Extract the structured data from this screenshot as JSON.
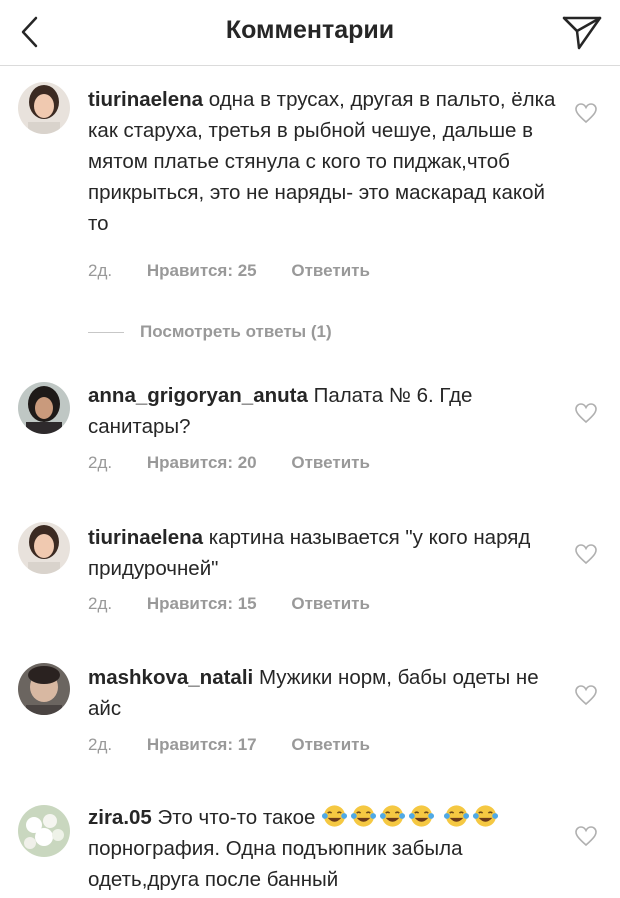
{
  "header": {
    "title": "Комментарии",
    "back_icon": "chevron-left-icon",
    "send_icon": "paper-plane-icon"
  },
  "comments": [
    {
      "username": "tiurinaelena",
      "text": "одна в трусах, другая в пальто, ёлка как старуха, третья в рыбной чешуе, дальше в мятом платье стянула с кого то пиджак,чтоб прикрыться, это не наряды- это маскарад какой то",
      "time": "2д.",
      "likes": "Нравится: 25",
      "reply": "Ответить"
    },
    {
      "username": "anna_grigoryan_anuta",
      "text": "Палата № 6. Где санитары?",
      "time": "2д.",
      "likes": "Нравится: 20",
      "reply": "Ответить"
    },
    {
      "username": "tiurinaelena",
      "text": "картина называется \"у кого наряд придурочней\"",
      "time": "2д.",
      "likes": "Нравится: 15",
      "reply": "Ответить"
    },
    {
      "username": "mashkova_natali",
      "text": "Мужики норм,  бабы одеты не айс",
      "time": "2д.",
      "likes": "Нравится: 17",
      "reply": "Ответить"
    },
    {
      "username": "zira.05",
      "text_before": "Это что-то такое",
      "text_after": "порнография. Одна подъюпник забыла одеть,друга после банный",
      "emoji_icon": "tears-of-joy-emoji-icon"
    }
  ],
  "view_replies": "Посмотреть ответы (1)",
  "colors": {
    "text": "#262626",
    "meta": "#999999",
    "divider": "#dbdbdb"
  }
}
